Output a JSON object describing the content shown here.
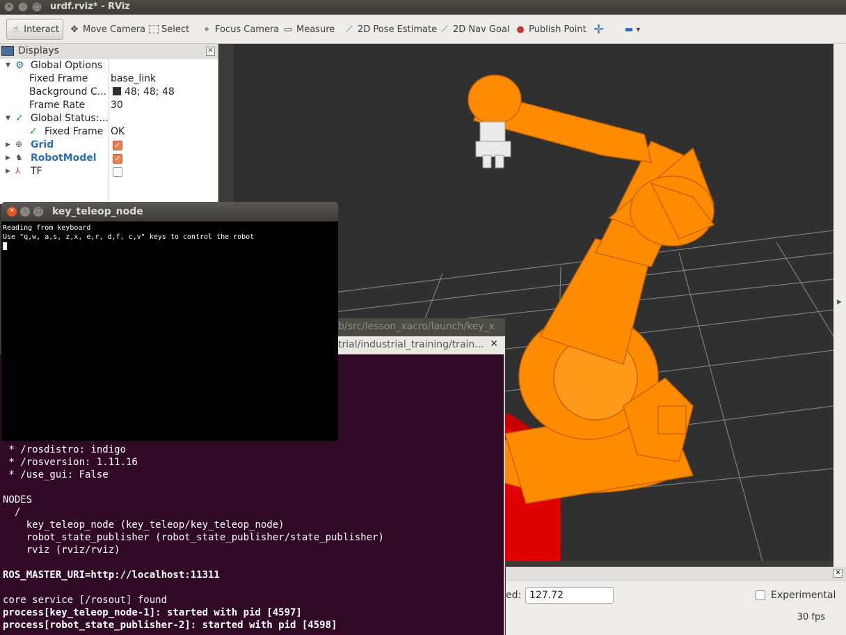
{
  "window": {
    "title": "urdf.rviz* - RViz"
  },
  "toolbar": {
    "items": [
      {
        "label": "Interact",
        "icon": "hand-icon"
      },
      {
        "label": "Move Camera",
        "icon": "move-camera-icon"
      },
      {
        "label": "Select",
        "icon": "select-icon"
      },
      {
        "label": "Focus Camera",
        "icon": "crosshair-icon"
      },
      {
        "label": "Measure",
        "icon": "ruler-icon"
      },
      {
        "label": "2D Pose Estimate",
        "icon": "green-arrow-icon"
      },
      {
        "label": "2D Nav Goal",
        "icon": "green-arrow-icon"
      },
      {
        "label": "Publish Point",
        "icon": "pin-icon"
      }
    ],
    "active": "Interact"
  },
  "displays": {
    "title": "Displays",
    "rows": [
      {
        "name": "Global Options",
        "value": ""
      },
      {
        "name": "Fixed Frame",
        "value": "base_link"
      },
      {
        "name": "Background C...",
        "value": "48; 48; 48"
      },
      {
        "name": "Frame Rate",
        "value": "30"
      },
      {
        "name": "Global Status:...",
        "value": ""
      },
      {
        "name": "Fixed Frame",
        "value": "OK"
      },
      {
        "name": "Grid",
        "checked": true
      },
      {
        "name": "RobotModel",
        "checked": true
      },
      {
        "name": "TF",
        "checked": false
      }
    ],
    "background_color": "#303030"
  },
  "key_teleop": {
    "title": "key_teleop_node",
    "lines": [
      "Reading from keyboard",
      "Use \"q,w, a,s, z,x, e,r, d,f, c,v\" keys to control the robot"
    ]
  },
  "terminal2": {
    "tab_title": "b/src/lesson_xacro/launch/key_x",
    "header_title": "trial/industrial_training/train...",
    "lines": [
      {
        "text": " * /rosdistro: indigo",
        "bold": false
      },
      {
        "text": " * /rosversion: 1.11.16",
        "bold": false
      },
      {
        "text": " * /use_gui: False",
        "bold": false
      },
      {
        "text": "",
        "bold": false
      },
      {
        "text": "NODES",
        "bold": false
      },
      {
        "text": "  /",
        "bold": false
      },
      {
        "text": "    key_teleop_node (key_teleop/key_teleop_node)",
        "bold": false
      },
      {
        "text": "    robot_state_publisher (robot_state_publisher/state_publisher)",
        "bold": false
      },
      {
        "text": "    rviz (rviz/rviz)",
        "bold": false
      },
      {
        "text": "",
        "bold": false
      },
      {
        "text": "ROS_MASTER_URI=http://localhost:11311",
        "bold": true
      },
      {
        "text": "",
        "bold": false
      },
      {
        "text": "core service [/rosout] found",
        "bold": false
      },
      {
        "text": "process[key_teleop_node-1]: started with pid [4597]",
        "bold": true
      },
      {
        "text": "process[robot_state_publisher-2]: started with pid [4598]",
        "bold": true
      }
    ]
  },
  "bottom_bar": {
    "speed_label": "ed:",
    "speed_value": "127.72",
    "experimental_label": "Experimental",
    "fps": "30 fps"
  },
  "colors": {
    "robot": "#ff8c00",
    "table": "#e00000",
    "viewport_bg": "#303030",
    "grid": "#a0a0a0",
    "terminal_bg": "#300a24"
  }
}
